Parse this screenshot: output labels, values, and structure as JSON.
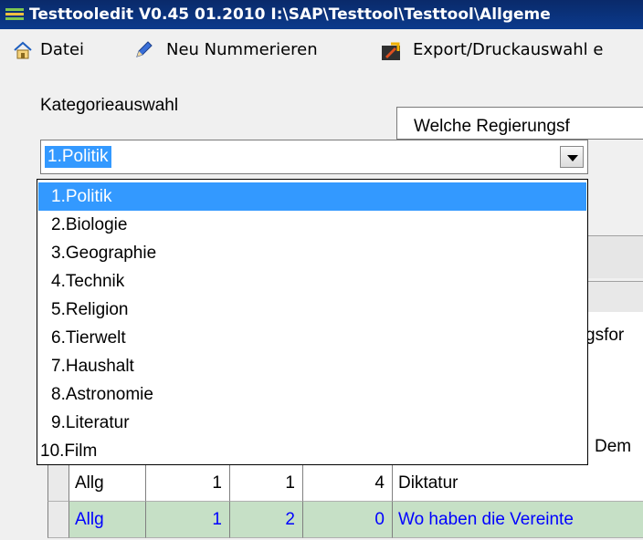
{
  "window": {
    "title": "Testtooledit V0.45 01.2010 I:\\SAP\\Testtool\\Testtool\\Allgeme"
  },
  "menu": {
    "items": [
      {
        "label": "Datei",
        "icon": "home-icon"
      },
      {
        "label": "Neu Nummerieren",
        "icon": "pencil-icon"
      },
      {
        "label": "Export/Druckauswahl e",
        "icon": "export-print-icon"
      }
    ]
  },
  "category": {
    "label": "Kategorieauswahl",
    "selected": "1.Politik",
    "options": [
      "1.Politik",
      "2.Biologie",
      "3.Geographie",
      "4.Technik",
      "5.Religion",
      "6.Tierwelt",
      "7.Haushalt",
      "8.Astronomie",
      "9.Literatur",
      "10.Film"
    ]
  },
  "question_combo": {
    "value": "Welche Regierungsf"
  },
  "background": {
    "partial_1": "gsfor",
    "partial_2": "Dem"
  },
  "table": {
    "rows": [
      {
        "kat": "Allg",
        "c1": "1",
        "c2": "1",
        "c3": "4",
        "text": "Diktatur"
      },
      {
        "kat": "Allg",
        "c1": "1",
        "c2": "2",
        "c3": "0",
        "text": "Wo haben die Vereinte"
      }
    ]
  },
  "colors": {
    "title_bar": "#0b3a8c",
    "selection": "#3399ff",
    "highlight_row": "#c6e0c6",
    "highlight_text": "#0000ff"
  }
}
